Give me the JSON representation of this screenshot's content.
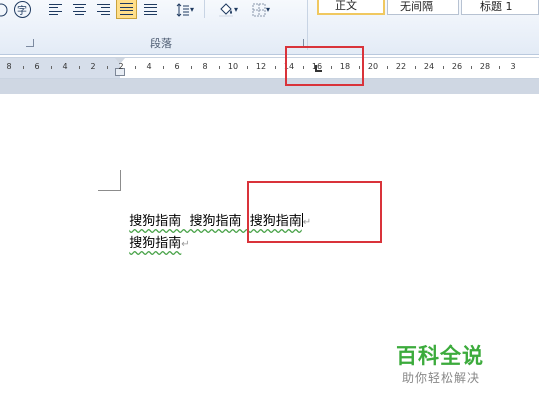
{
  "ribbon": {
    "buttons": {
      "font_glyph": "字",
      "line_spacing_dropdown": "▾",
      "shading_dropdown": "▾",
      "borders_dropdown": "▾"
    },
    "group_label": "段落",
    "styles": [
      "正文",
      "无间隔",
      "标题 1"
    ],
    "selected_style": "正文"
  },
  "ruler": {
    "numbers": [
      "8",
      "6",
      "4",
      "2",
      "2",
      "4",
      "6",
      "8",
      "10",
      "12",
      "14",
      "16",
      "18",
      "20",
      "22",
      "24",
      "26",
      "28",
      "3"
    ]
  },
  "document": {
    "lines": [
      "搜狗指南  搜狗指南  搜狗指南",
      "搜狗指南"
    ],
    "paragraph_mark": "↵"
  },
  "watermark": {
    "title": "百科全说",
    "subtitle": "助你轻松解决"
  },
  "colors": {
    "highlight": "#d9333a",
    "watermark_green": "#3cab3c",
    "active_button": "#ffdf8a"
  }
}
